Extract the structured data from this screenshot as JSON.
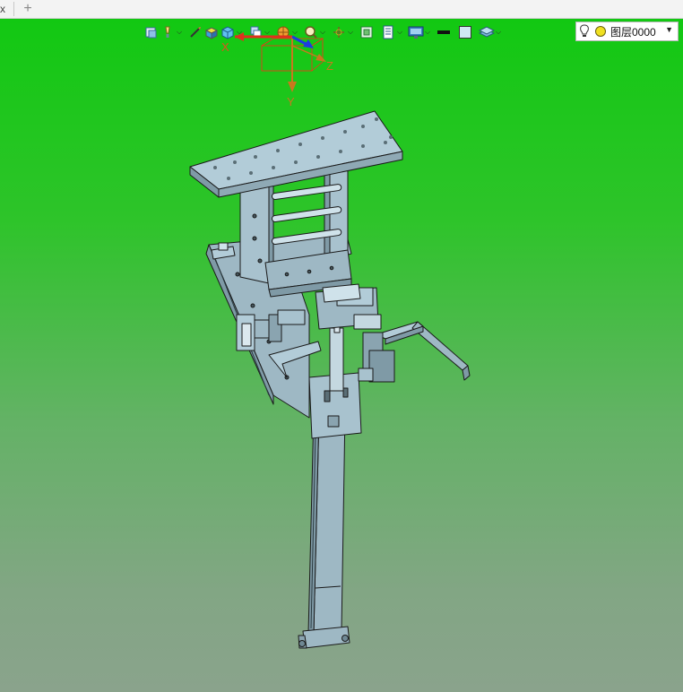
{
  "tab_bar": {
    "close_glyph": "x",
    "new_tab_glyph": "+"
  },
  "toolbar": {
    "icons": [
      "view-layout-icon",
      "light-icon",
      "measure-icon",
      "shaded-box-icon",
      "wire-cube-icon",
      "triad-view-icon",
      "render-sphere-icon",
      "zoom-icon",
      "rotate-icon",
      "frame-icon",
      "display-icon",
      "monitor-icon",
      "line-color-icon",
      "fill-color-icon",
      "layer-stack-icon"
    ],
    "layer_selector": {
      "value": "图层0000",
      "icons": [
        "bulb-icon",
        "layer-color-icon"
      ]
    }
  },
  "triad": {
    "x_label": "X",
    "y_label": "Y",
    "z_label": "Z",
    "colors": {
      "x": "#e0301e",
      "y": "#c8781e",
      "z": "#1e3ce0",
      "box": "#ff2a1a"
    }
  },
  "model": {
    "fill": "#9eb8c4",
    "stroke": "#1a1a1a",
    "highlight": "#d6e4ea"
  }
}
